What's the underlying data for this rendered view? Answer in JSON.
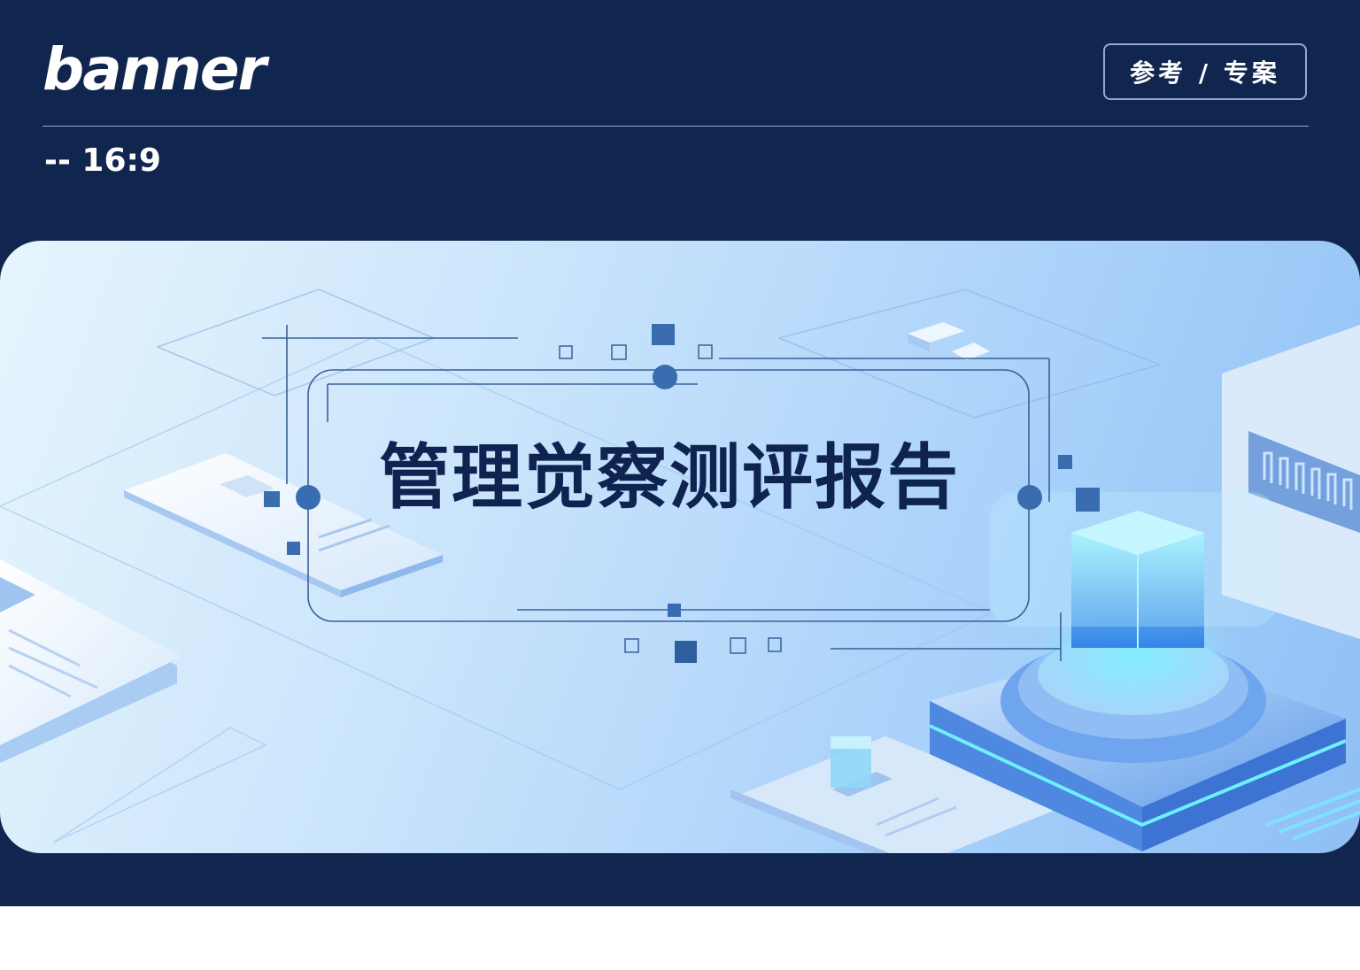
{
  "header": {
    "brand": "banner",
    "tag_button": "参考 / 专案",
    "ratio_label": "-- 16:9"
  },
  "banner": {
    "title": "管理觉察测评报告"
  },
  "colors": {
    "background": "#11264e",
    "title_text": "#0f2350",
    "accent_blue": "#3f6fae",
    "glow_cyan": "#5fe6ff"
  }
}
